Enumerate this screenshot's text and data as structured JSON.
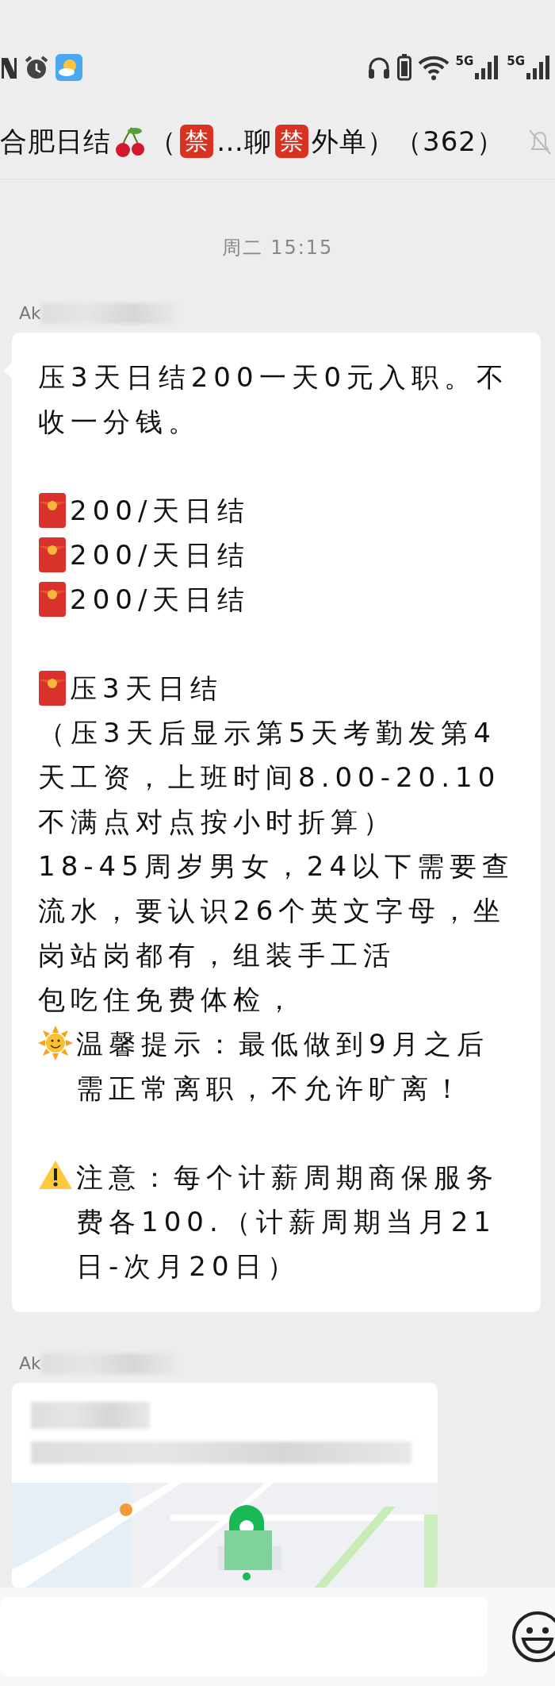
{
  "status_bar": {
    "signals": [
      {
        "label": "5G"
      },
      {
        "label": "5G"
      }
    ]
  },
  "chat_title": {
    "segments": [
      {
        "kind": "text",
        "text": "合肥日结"
      },
      {
        "kind": "cherry"
      },
      {
        "kind": "text",
        "text": "（"
      },
      {
        "kind": "ban",
        "text": "禁"
      },
      {
        "kind": "text",
        "text": "…聊"
      },
      {
        "kind": "ban",
        "text": "禁"
      },
      {
        "kind": "text",
        "text": "外单）（362）"
      }
    ],
    "muted": true
  },
  "timestamp": "周二 15:15",
  "messages": [
    {
      "kind": "text",
      "sender": "Ak",
      "blocks": [
        [
          {
            "kind": "plain",
            "text": "压3天日结200一天0元入职。不收一分钱。"
          }
        ],
        [
          {
            "kind": "envelope",
            "text": "200/天日结"
          },
          {
            "kind": "envelope",
            "text": "200/天日结"
          },
          {
            "kind": "envelope",
            "text": "200/天日结"
          }
        ],
        [
          {
            "kind": "envelope",
            "text": "压3天日结"
          },
          {
            "kind": "plain",
            "text": "（压3天后显示第5天考勤发第4天工资，上班时间8.00-20.10不满点对点按小时折算）"
          },
          {
            "kind": "plain",
            "text": "18-45周岁男女，24以下需要查流水，要认识26个英文字母，坐岗站岗都有，组装手工活"
          },
          {
            "kind": "plain",
            "text": "包吃住免费体检，"
          },
          {
            "kind": "sun",
            "text": "温馨提示：最低做到9月之后需正常离职，不允许旷离！"
          }
        ],
        [
          {
            "kind": "warning",
            "text": "注意：每个计薪周期商保服务费各100.（计薪周期当月21日-次月20日）"
          }
        ]
      ]
    },
    {
      "kind": "location",
      "sender": "Ak"
    }
  ]
}
